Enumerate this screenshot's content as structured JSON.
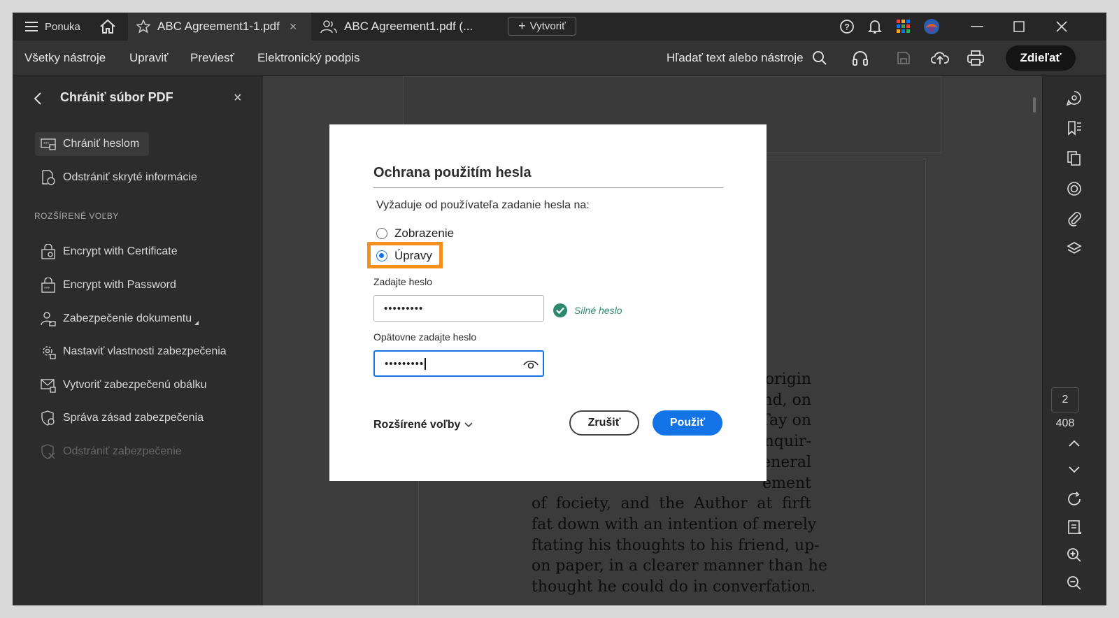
{
  "titlebar": {
    "menu_label": "Ponuka",
    "tabs": [
      {
        "label": "ABC Agreement1-1.pdf"
      },
      {
        "label": "ABC Agreement1.pdf (..."
      }
    ],
    "new_label": "Vytvoriť"
  },
  "menubar": {
    "items": [
      {
        "label": "Všetky nástroje"
      },
      {
        "label": "Upraviť"
      },
      {
        "label": "Previesť"
      },
      {
        "label": "Elektronický podpis"
      }
    ],
    "search_label": "Hľadať text alebo nástroje",
    "share_label": "Zdieľať"
  },
  "sidebar": {
    "title": "Chrániť súbor PDF",
    "top_items": [
      {
        "label": "Chrániť heslom"
      },
      {
        "label": "Odstrániť skryté informácie"
      }
    ],
    "section_label": "ROZŠÍRENÉ VOĽBY",
    "adv_items": [
      {
        "label": "Encrypt with Certificate"
      },
      {
        "label": "Encrypt with Password"
      },
      {
        "label": "Zabezpečenie dokumentu"
      },
      {
        "label": "Nastaviť vlastnosti zabezpečenia"
      },
      {
        "label": "Vytvoriť zabezpečenú obálku"
      },
      {
        "label": "Správa zásad zabezpečenia"
      },
      {
        "label": "Odstrániť zabezpečenie"
      }
    ]
  },
  "document": {
    "lines": [
      "origin",
      "nd, on",
      "Tay on",
      "nquir-",
      "general",
      "ement",
      "of fociety, and the Author at firft",
      "fat down with an intention of merely",
      "ftating his thoughts to his friend, up-",
      "on paper, in a clearer manner than he",
      "thought he could do in converfation."
    ]
  },
  "pager": {
    "current": "2",
    "total": "408"
  },
  "dialog": {
    "title": "Ochrana použitím hesla",
    "subtitle": "Vyžaduje od používateľa zadanie hesla na:",
    "option_view": "Zobrazenie",
    "option_edit": "Úpravy",
    "password_label": "Zadajte heslo",
    "password_value": "•••••••••",
    "strength_label": "Silné heslo",
    "confirm_label": "Opätovne zadajte heslo",
    "confirm_value": "•••••••••",
    "advanced_label": "Rozšírené voľby",
    "cancel_label": "Zrušiť",
    "apply_label": "Použiť",
    "accent": "#1473e6",
    "highlight": "#f5901e"
  }
}
